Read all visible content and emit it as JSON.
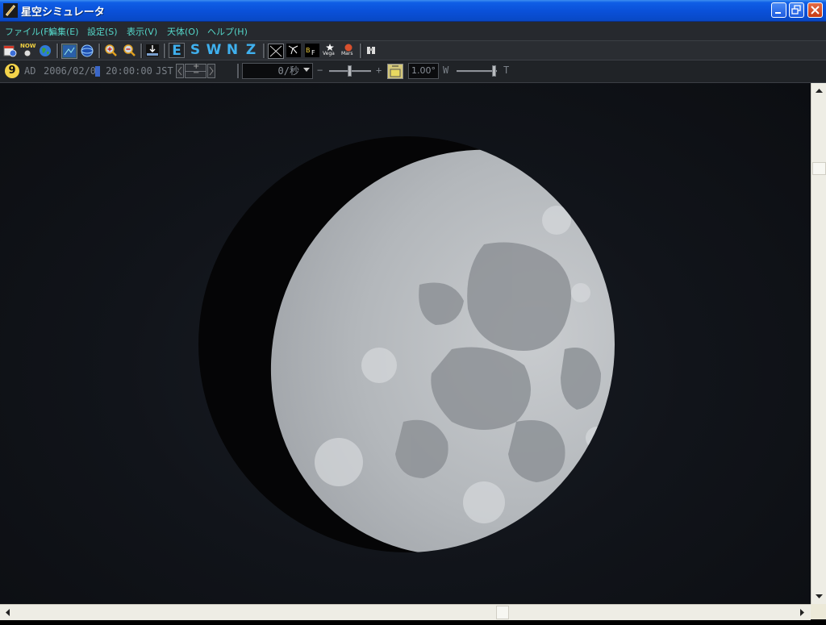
{
  "window": {
    "title": "星空シミュレータ"
  },
  "menu": [
    {
      "label": "ファイル(F)"
    },
    {
      "label": "編集(E)"
    },
    {
      "label": "設定(S)"
    },
    {
      "label": "表示(V)"
    },
    {
      "label": "天体(O)"
    },
    {
      "label": "ヘルプ(H)"
    }
  ],
  "toolbar": {
    "now_label": "NOW",
    "directions": [
      "E",
      "S",
      "W",
      "N",
      "Z"
    ],
    "vega_label": "Vega",
    "mars_label": "Mars"
  },
  "timebar": {
    "moon_age": "9",
    "era": "AD",
    "date": "2006/02/0",
    "time": "20:00:00",
    "timezone": "JST",
    "rate_value": "0/秒",
    "rate_minus": "−",
    "rate_plus": "+",
    "fov_value": "1.00°",
    "zoom_wide": "W",
    "zoom_tele": "T"
  },
  "moon": {
    "phase": "waxing gibbous",
    "lit_color": "#c9cccf",
    "shadow_color": "#050506"
  },
  "colors": {
    "menu_text": "#54d6c8",
    "direction_text": "#3fb0ee",
    "titlebar": "#0a50d8"
  }
}
